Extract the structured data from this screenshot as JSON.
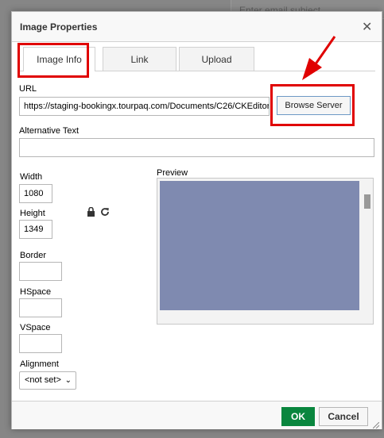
{
  "background": {
    "email_subject_placeholder": "Enter email subject"
  },
  "dialog": {
    "title": "Image Properties",
    "close_icon": "close-icon",
    "tabs": [
      {
        "label": "Image Info",
        "active": true
      },
      {
        "label": "Link",
        "active": false
      },
      {
        "label": "Upload",
        "active": false
      }
    ],
    "url": {
      "label": "URL",
      "value": "https://staging-bookingx.tourpaq.com/Documents/C26/CKEditor"
    },
    "browse_server_label": "Browse Server",
    "alt_text": {
      "label": "Alternative Text",
      "value": ""
    },
    "width": {
      "label": "Width",
      "value": "1080"
    },
    "height": {
      "label": "Height",
      "value": "1349"
    },
    "lock_icon": "lock-icon",
    "reset_icon": "reset-size-icon",
    "border": {
      "label": "Border",
      "value": ""
    },
    "hspace": {
      "label": "HSpace",
      "value": ""
    },
    "vspace": {
      "label": "VSpace",
      "value": ""
    },
    "alignment": {
      "label": "Alignment",
      "selected": "<not set>"
    },
    "preview_label": "Preview",
    "ok_label": "OK",
    "cancel_label": "Cancel"
  },
  "annotations": {
    "highlight_color": "#e00000"
  },
  "colors": {
    "ok_button": "#09863e",
    "preview_image": "#7f8ab0"
  }
}
